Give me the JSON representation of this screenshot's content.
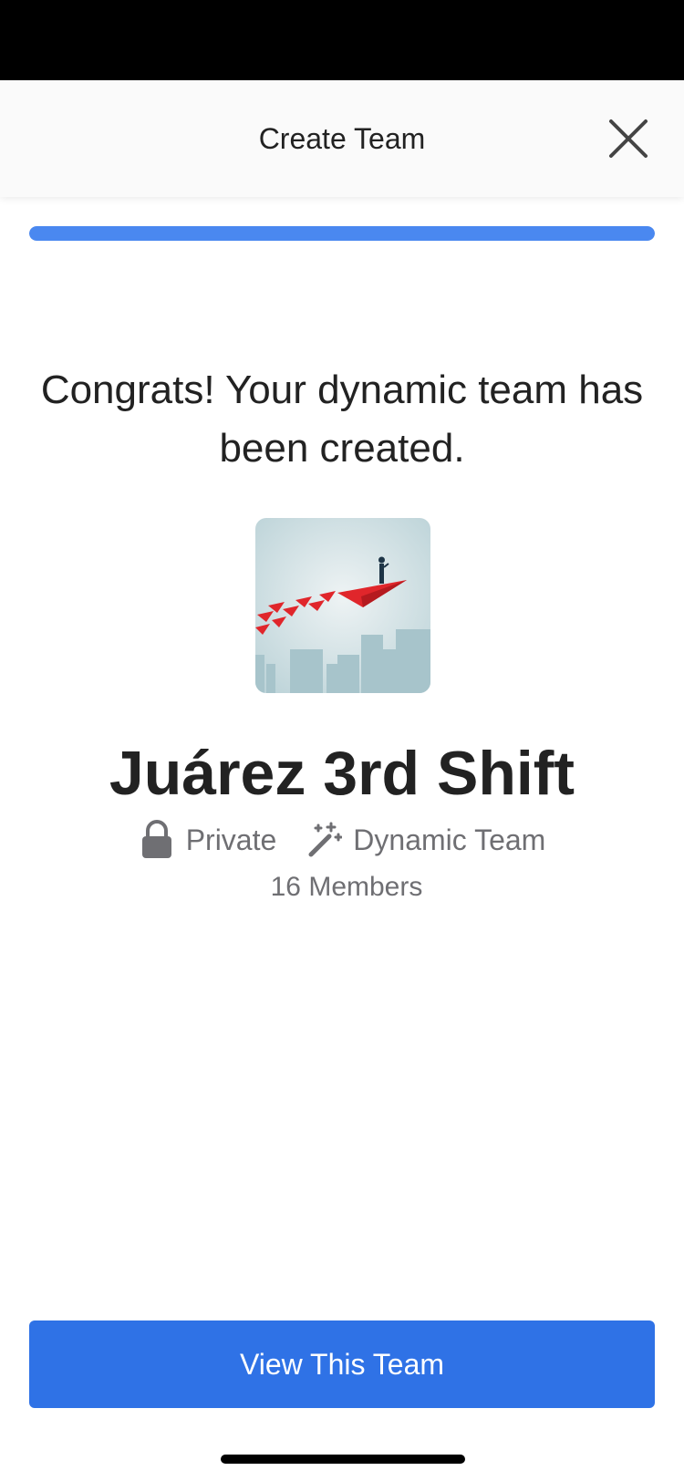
{
  "header": {
    "title": "Create Team"
  },
  "progress": {
    "fraction": 1.0,
    "color": "#4a88f0"
  },
  "message": {
    "congrats": "Congrats! Your dynamic team has been created."
  },
  "team": {
    "name": "Juárez 3rd Shift",
    "privacy": "Private",
    "type": "Dynamic Team",
    "members": "16 Members"
  },
  "actions": {
    "view_team": "View This Team"
  },
  "colors": {
    "accent": "#2f72e6",
    "muted_text": "#6f6f73"
  },
  "icons": {
    "close": "close-icon",
    "privacy": "lock-icon",
    "team_type": "magic-wand-icon"
  }
}
